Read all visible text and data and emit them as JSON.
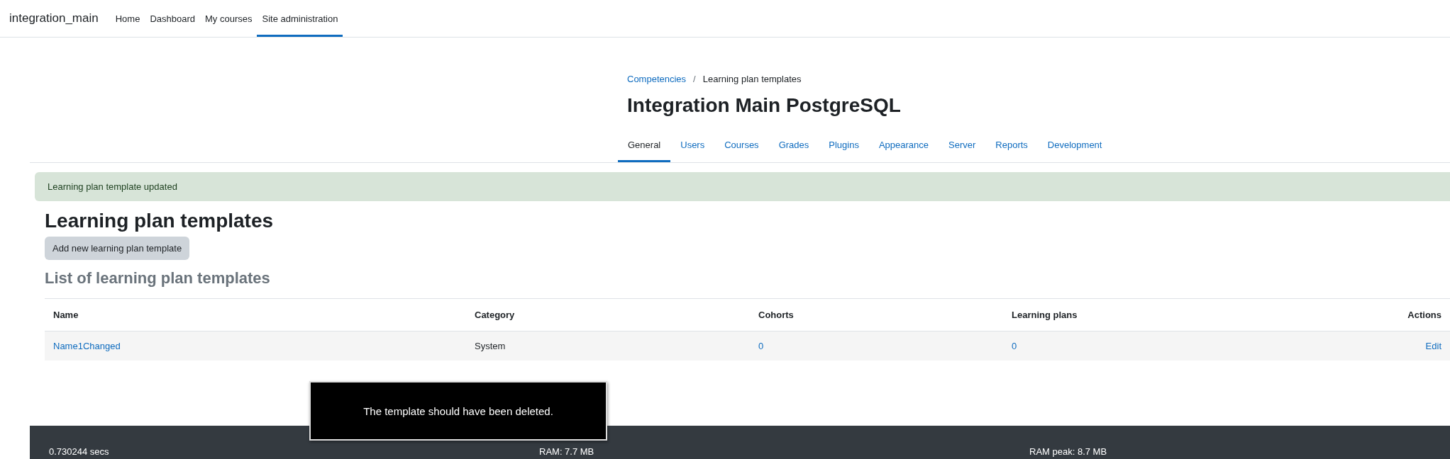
{
  "navbar": {
    "brand": "integration_main",
    "items": [
      {
        "label": "Home",
        "selected": false
      },
      {
        "label": "Dashboard",
        "selected": false
      },
      {
        "label": "My courses",
        "selected": false
      },
      {
        "label": "Site administration",
        "selected": true
      }
    ]
  },
  "breadcrumb": [
    {
      "label": "Competencies",
      "kind": "link"
    },
    {
      "label": "Learning plan templates",
      "kind": "current"
    }
  ],
  "breadcrumb_separator": "/",
  "page_title": "Integration Main PostgreSQL",
  "tabs": [
    {
      "label": "General",
      "selected": true
    },
    {
      "label": "Users",
      "selected": false
    },
    {
      "label": "Courses",
      "selected": false
    },
    {
      "label": "Grades",
      "selected": false
    },
    {
      "label": "Plugins",
      "selected": false
    },
    {
      "label": "Appearance",
      "selected": false
    },
    {
      "label": "Server",
      "selected": false
    },
    {
      "label": "Reports",
      "selected": false
    },
    {
      "label": "Development",
      "selected": false
    }
  ],
  "alert": "Learning plan template updated",
  "heading": "Learning plan templates",
  "add_button": "Add new learning plan template",
  "list_heading": "List of learning plan templates",
  "table": {
    "columns": [
      "Name",
      "Category",
      "Cohorts",
      "Learning plans",
      "Actions"
    ],
    "rows": [
      [
        "Name1Changed",
        "System",
        "0",
        "0",
        "Edit"
      ]
    ]
  },
  "overlay_message": "The template should have been deleted.",
  "footer": [
    "0.730244 secs",
    "RAM: 7.7 MB",
    "RAM peak: 8.7 MB"
  ]
}
